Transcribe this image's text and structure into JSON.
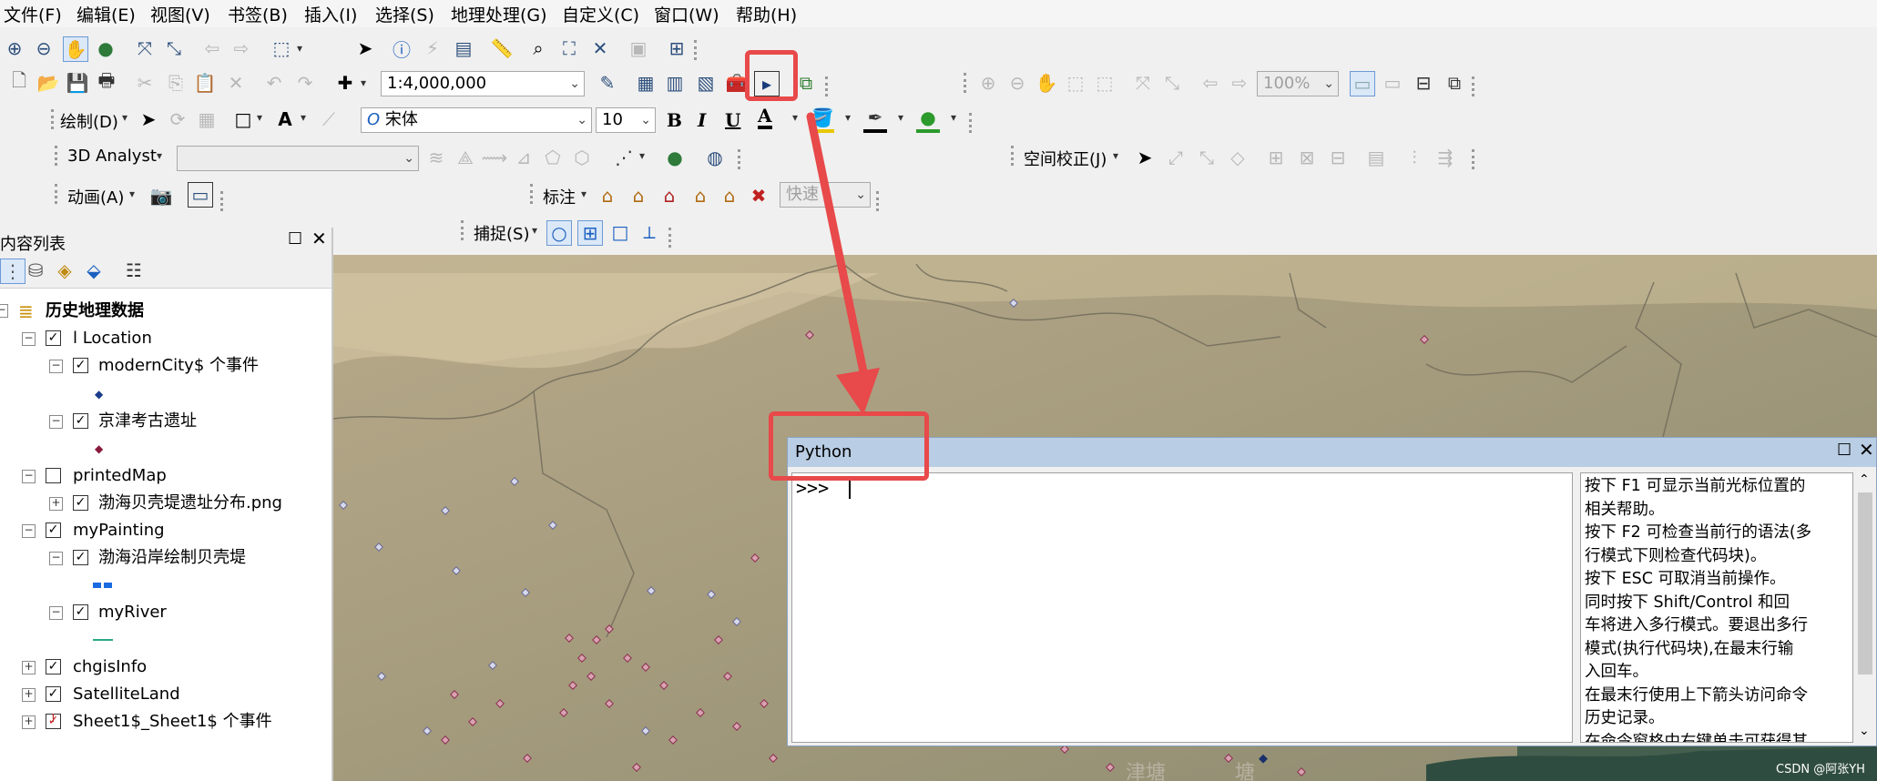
{
  "menu": [
    "文件(F)",
    "编辑(E)",
    "视图(V)",
    "书签(B)",
    "插入(I)",
    "选择(S)",
    "地理处理(G)",
    "自定义(C)",
    "窗口(W)",
    "帮助(H)"
  ],
  "standard": {
    "scale": "1:4,000,000",
    "zoom_percent": "100%"
  },
  "draw_toolbar": {
    "label": "绘制(D)",
    "font": "宋体",
    "font_size": "10",
    "bold": "B",
    "italic": "I",
    "underline": "U",
    "text_color_glyph": "A"
  },
  "analyst_toolbar": {
    "label": "3D Analyst",
    "layer_value": ""
  },
  "georef_toolbar": {
    "label": "空间校正(J)"
  },
  "animation_toolbar": {
    "label": "动画(A)"
  },
  "label_toolbar": {
    "label": "标注",
    "speed": "快速"
  },
  "snap_toolbar": {
    "label": "捕捉(S)"
  },
  "toc": {
    "title": "内容列表",
    "root": "历史地理数据",
    "layers": [
      {
        "name": "l Location"
      },
      {
        "name": "modernCity$ 个事件"
      },
      {
        "name": "京津考古遗址"
      },
      {
        "name": "printedMap"
      },
      {
        "name": "渤海贝壳堤遗址分布.png"
      },
      {
        "name": "myPainting"
      },
      {
        "name": "渤海沿岸绘制贝壳堤"
      },
      {
        "name": "myRiver"
      },
      {
        "name": "chgisInfo"
      },
      {
        "name": "SatelliteLand"
      },
      {
        "name": "Sheet1$_Sheet1$ 个事件"
      }
    ]
  },
  "map": {
    "labels": [
      "津塘",
      "塘"
    ]
  },
  "python": {
    "title": "Python",
    "prompt": ">>>",
    "help_lines": [
      "按下 F1 可显示当前光标位置的",
      "相关帮助。",
      "按下 F2 可检查当前行的语法(多",
      "行模式下则检查代码块)。",
      "按下 ESC 可取消当前操作。",
      "同时按下 Shift/Control 和回",
      "车将进入多行模式。要退出多行",
      "模式(执行代码块),在最末行输",
      "入回车。",
      "在最末行使用上下箭头访问命令",
      "历史记录。",
      "在命令窗格中右键单击可获得其"
    ]
  },
  "watermark": "CSDN @阿张YH",
  "colors": {
    "highlight": "#e8494a",
    "python_title": "#b9cde4",
    "toc_bg": "#ffffff"
  }
}
